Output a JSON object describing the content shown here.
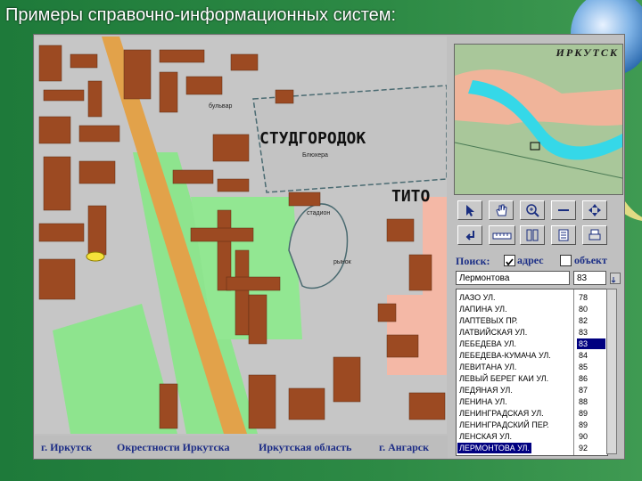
{
  "slide": {
    "title": "Примеры справочно-информационных систем:"
  },
  "map": {
    "labels": {
      "district1": "СТУДГОРОДОК",
      "district2": "ТИТО",
      "small1": "бульвар",
      "small2": "Блюхера",
      "small3": "рынок",
      "small4": "стадион"
    }
  },
  "bottom_links": [
    "г. Иркутск",
    "Окрестности Иркутска",
    "Иркутская область",
    "г. Ангарск"
  ],
  "minimap": {
    "title": "ИРКУТСК"
  },
  "tools": [
    "pointer-icon",
    "hand-icon",
    "zoom-in-icon",
    "zoom-out-icon",
    "pan-arrows-icon",
    "back-icon",
    "ruler-icon",
    "layers-icon",
    "list-icon",
    "print-icon"
  ],
  "search": {
    "label": "Поиск:",
    "option_address": "адрес",
    "option_object": "объект",
    "street_value": "Лермонтова",
    "number_value": "83"
  },
  "list": {
    "streets": [
      "ЛАЗО УЛ.",
      "ЛАПИНА УЛ.",
      "ЛАПТЕВЫХ ПР.",
      "ЛАТВИЙСКАЯ УЛ.",
      "ЛЕБЕДЕВА УЛ.",
      "ЛЕБЕДЕВА-КУМАЧА УЛ.",
      "ЛЕВИТАНА УЛ.",
      "ЛЕВЫЙ БЕРЕГ КАИ УЛ.",
      "ЛЕДЯНАЯ УЛ.",
      "ЛЕНИНА УЛ.",
      "ЛЕНИНГРАДСКАЯ УЛ.",
      "ЛЕНИНГРАДСКИЙ ПЕР.",
      "ЛЕНСКАЯ УЛ.",
      "ЛЕРМОНТОВА УЛ."
    ],
    "numbers": [
      "78",
      "80",
      "82",
      "83",
      "83",
      "84",
      "85",
      "86",
      "87",
      "88",
      "89",
      "89",
      "90",
      "92"
    ],
    "selected_street_index": 13,
    "selected_number_index": 4
  }
}
